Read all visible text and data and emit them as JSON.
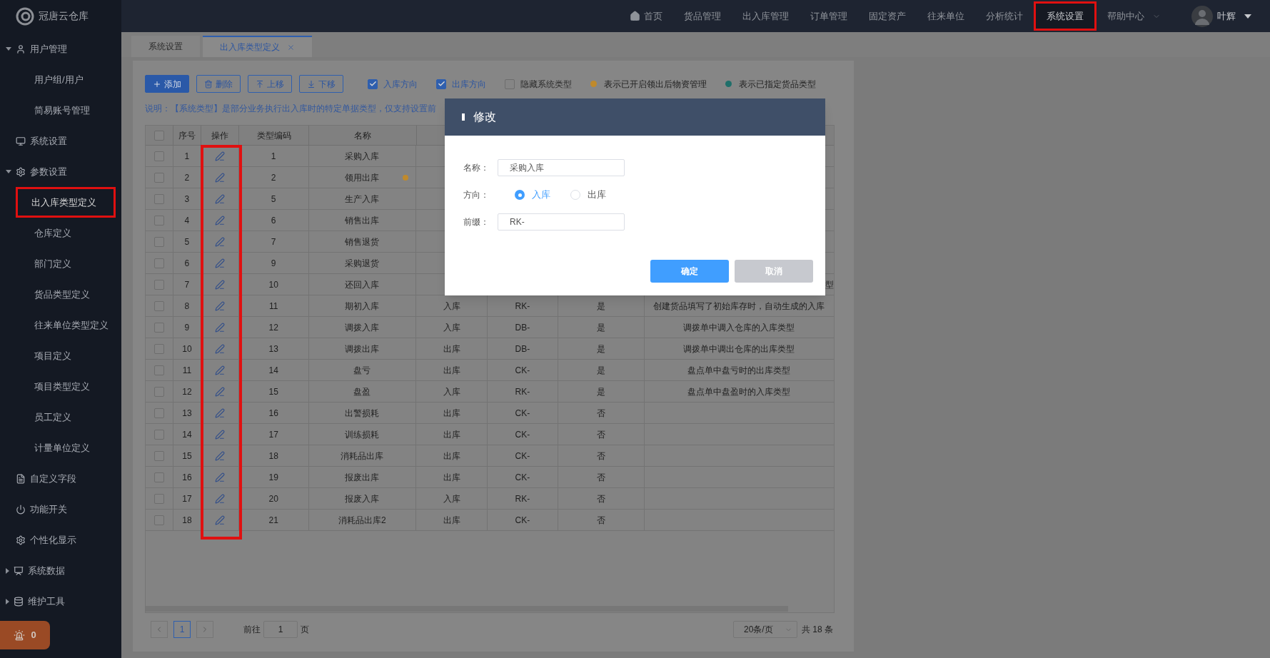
{
  "brand": {
    "name": "冠唐云仓库"
  },
  "top_nav": [
    {
      "label": "首页",
      "kind": "home",
      "selected": false
    },
    {
      "label": "货品管理",
      "kind": "plain",
      "selected": false
    },
    {
      "label": "出入库管理",
      "kind": "plain",
      "selected": false
    },
    {
      "label": "订单管理",
      "kind": "plain",
      "selected": false
    },
    {
      "label": "固定资产",
      "kind": "plain",
      "selected": false
    },
    {
      "label": "往来单位",
      "kind": "plain",
      "selected": false
    },
    {
      "label": "分析统计",
      "kind": "plain",
      "selected": false
    },
    {
      "label": "系统设置",
      "kind": "plain",
      "selected": true
    },
    {
      "label": "帮助中心",
      "kind": "dropdown",
      "selected": false
    }
  ],
  "user": {
    "name": "叶辉"
  },
  "sidebar": {
    "items": [
      {
        "label": "用户管理",
        "kind": "user",
        "expanded": true,
        "children": [
          {
            "label": "用户组/用户",
            "selected": false
          },
          {
            "label": "简易账号管理",
            "selected": false
          }
        ]
      },
      {
        "label": "系统设置",
        "kind": "monitor"
      },
      {
        "label": "参数设置",
        "kind": "gear",
        "expanded": true,
        "children": [
          {
            "label": "出入库类型定义",
            "selected": true
          },
          {
            "label": "仓库定义",
            "selected": false
          },
          {
            "label": "部门定义",
            "selected": false
          },
          {
            "label": "货品类型定义",
            "selected": false
          },
          {
            "label": "往来单位类型定义",
            "selected": false
          },
          {
            "label": "项目定义",
            "selected": false
          },
          {
            "label": "项目类型定义",
            "selected": false
          },
          {
            "label": "员工定义",
            "selected": false
          },
          {
            "label": "计量单位定义",
            "selected": false
          }
        ]
      },
      {
        "label": "自定义字段",
        "kind": "form"
      },
      {
        "label": "功能开关",
        "kind": "power"
      },
      {
        "label": "个性化显示",
        "kind": "gear"
      },
      {
        "label": "系统数据",
        "kind": "chart",
        "expanded": false
      },
      {
        "label": "维护工具",
        "kind": "database",
        "expanded": false
      }
    ],
    "alert": {
      "count": "0"
    }
  },
  "tabs": [
    {
      "label": "系统设置",
      "selected": false
    },
    {
      "label": "出入库类型定义",
      "selected": true
    }
  ],
  "toolbar": {
    "buttons": [
      {
        "label": "添加",
        "kind": "add"
      },
      {
        "label": "删除",
        "kind": "delete"
      },
      {
        "label": "上移",
        "kind": "up"
      },
      {
        "label": "下移",
        "kind": "down"
      }
    ],
    "checkboxes": [
      {
        "label": "入库方向",
        "checked": true
      },
      {
        "label": "出库方向",
        "checked": true
      },
      {
        "label": "隐藏系统类型",
        "checked": false
      }
    ],
    "legend": [
      {
        "label": "表示已开启领出后物资管理",
        "color": "#c08a2c"
      },
      {
        "label": "表示已指定货品类型",
        "color": "#1f6f6a"
      }
    ]
  },
  "note": "说明：【系统类型】是部分业务执行出入库时的特定单据类型，仅支持设置前",
  "table": {
    "header_checked": false,
    "columns": [
      "序号",
      "操作",
      "类型编码",
      "名称"
    ],
    "rows": [
      {
        "checked": false,
        "no": "1",
        "code": "1",
        "name": "采购入库"
      },
      {
        "checked": false,
        "no": "2",
        "code": "2",
        "name": "领用出库",
        "marked": true
      },
      {
        "checked": false,
        "no": "3",
        "code": "5",
        "name": "生产入库"
      },
      {
        "checked": false,
        "no": "4",
        "code": "6",
        "name": "销售出库"
      },
      {
        "checked": false,
        "no": "5",
        "code": "7",
        "name": "销售退货"
      },
      {
        "checked": false,
        "no": "6",
        "code": "9",
        "name": "采购退货"
      },
      {
        "checked": false,
        "no": "7",
        "code": "10",
        "name": "还回入库",
        "description_tail": "型"
      },
      {
        "checked": false,
        "no": "8",
        "code": "11",
        "name": "期初入库",
        "direction": "入库",
        "prefix": "RK-",
        "system": "是",
        "description": "创建货品填写了初始库存时，自动生成的入库"
      },
      {
        "checked": false,
        "no": "9",
        "code": "12",
        "name": "调拨入库",
        "direction": "入库",
        "prefix": "DB-",
        "system": "是",
        "description": "调拨单中调入仓库的入库类型"
      },
      {
        "checked": false,
        "no": "10",
        "code": "13",
        "name": "调拨出库",
        "direction": "出库",
        "prefix": "DB-",
        "system": "是",
        "description": "调拨单中调出仓库的出库类型"
      },
      {
        "checked": false,
        "no": "11",
        "code": "14",
        "name": "盘亏",
        "direction": "出库",
        "prefix": "CK-",
        "system": "是",
        "description": "盘点单中盘亏时的出库类型"
      },
      {
        "checked": false,
        "no": "12",
        "code": "15",
        "name": "盘盈",
        "direction": "入库",
        "prefix": "RK-",
        "system": "是",
        "description": "盘点单中盘盈时的入库类型"
      },
      {
        "checked": false,
        "no": "13",
        "code": "16",
        "name": "出警损耗",
        "direction": "出库",
        "prefix": "CK-",
        "system": "否"
      },
      {
        "checked": false,
        "no": "14",
        "code": "17",
        "name": "训练损耗",
        "direction": "出库",
        "prefix": "CK-",
        "system": "否"
      },
      {
        "checked": false,
        "no": "15",
        "code": "18",
        "name": "消耗品出库",
        "direction": "出库",
        "prefix": "CK-",
        "system": "否"
      },
      {
        "checked": false,
        "no": "16",
        "code": "19",
        "name": "报废出库",
        "direction": "出库",
        "prefix": "CK-",
        "system": "否"
      },
      {
        "checked": false,
        "no": "17",
        "code": "20",
        "name": "报废入库",
        "direction": "入库",
        "prefix": "RK-",
        "system": "否"
      },
      {
        "checked": false,
        "no": "18",
        "code": "21",
        "name": "消耗品出库2",
        "direction": "出库",
        "prefix": "CK-",
        "system": "否"
      }
    ]
  },
  "pagination": {
    "page": "1",
    "goto_label": "前往",
    "goto_value": "1",
    "page_suffix": "页",
    "page_size": "20条/页",
    "total": "共 18 条"
  },
  "dialog": {
    "title": "修改",
    "fields": [
      {
        "label": "名称：",
        "kind": "text",
        "value": "采购入库"
      },
      {
        "label": "方向：",
        "kind": "radio",
        "options": [
          {
            "label": "入库",
            "selected": true
          },
          {
            "label": "出库",
            "selected": false
          }
        ]
      },
      {
        "label": "前缀：",
        "kind": "text",
        "value": "RK-"
      }
    ],
    "buttons": [
      {
        "label": "确定",
        "kind": "primary"
      },
      {
        "label": "取消",
        "kind": "secondary"
      }
    ]
  }
}
